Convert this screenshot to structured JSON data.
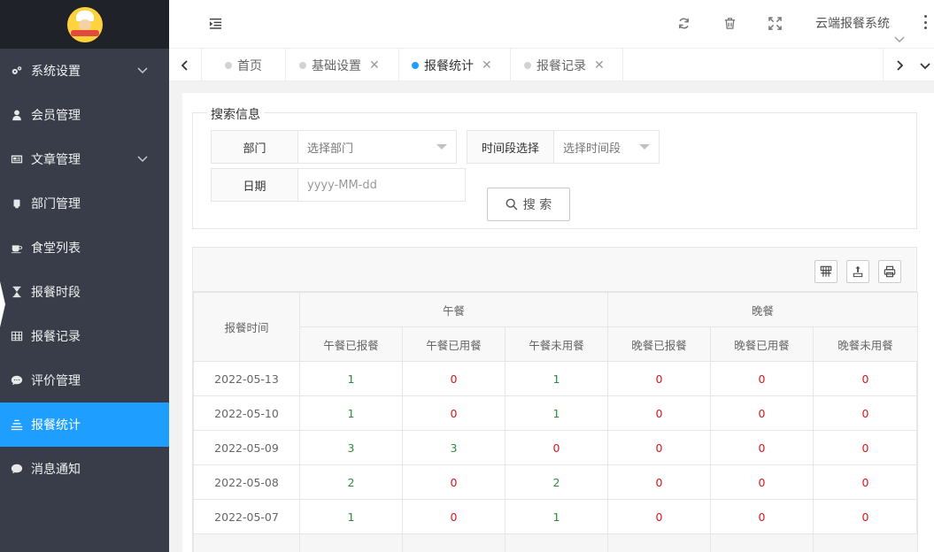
{
  "app": {
    "system_name": "云端报餐系统"
  },
  "sidebar": {
    "items": [
      {
        "label": "系统设置",
        "icon": "gears-icon",
        "has_children": true
      },
      {
        "label": "会员管理",
        "icon": "user-icon",
        "has_children": false
      },
      {
        "label": "文章管理",
        "icon": "article-icon",
        "has_children": true
      },
      {
        "label": "部门管理",
        "icon": "department-icon",
        "has_children": false
      },
      {
        "label": "食堂列表",
        "icon": "coffee-icon",
        "has_children": false
      },
      {
        "label": "报餐时段",
        "icon": "hourglass-icon",
        "has_children": false
      },
      {
        "label": "报餐记录",
        "icon": "grid-icon",
        "has_children": false
      },
      {
        "label": "评价管理",
        "icon": "comment-icon",
        "has_children": false
      },
      {
        "label": "报餐统计",
        "icon": "list-icon",
        "has_children": false,
        "active": true
      },
      {
        "label": "消息通知",
        "icon": "message-icon",
        "has_children": false
      }
    ]
  },
  "tabs": [
    {
      "label": "首页",
      "closable": false,
      "active": false
    },
    {
      "label": "基础设置",
      "closable": true,
      "active": false
    },
    {
      "label": "报餐统计",
      "closable": true,
      "active": true
    },
    {
      "label": "报餐记录",
      "closable": true,
      "active": false
    }
  ],
  "search": {
    "legend": "搜索信息",
    "department_label": "部门",
    "department_value": "选择部门",
    "period_label": "时间段选择",
    "period_value": "选择时间段",
    "date_label": "日期",
    "date_placeholder": "yyyy-MM-dd",
    "button_label": "搜 索"
  },
  "table": {
    "time_header": "报餐时间",
    "lunch_header": "午餐",
    "dinner_header": "晚餐",
    "sub_headers": [
      "午餐已报餐",
      "午餐已用餐",
      "午餐未用餐",
      "晚餐已报餐",
      "晚餐已用餐",
      "晚餐未用餐"
    ],
    "rows": [
      {
        "date": "2022-05-13",
        "values": [
          "1",
          "0",
          "1",
          "0",
          "0",
          "0"
        ]
      },
      {
        "date": "2022-05-10",
        "values": [
          "1",
          "0",
          "1",
          "0",
          "0",
          "0"
        ]
      },
      {
        "date": "2022-05-09",
        "values": [
          "3",
          "3",
          "0",
          "0",
          "0",
          "0"
        ]
      },
      {
        "date": "2022-05-08",
        "values": [
          "2",
          "0",
          "2",
          "0",
          "0",
          "0"
        ]
      },
      {
        "date": "2022-05-07",
        "values": [
          "1",
          "0",
          "1",
          "0",
          "0",
          "0"
        ]
      }
    ]
  },
  "colors": {
    "sidebar_bg": "#393d49",
    "logo_bg": "#20222a",
    "accent": "#1e9fff",
    "positive": "#2e8c3c",
    "zero": "#d9161c"
  }
}
